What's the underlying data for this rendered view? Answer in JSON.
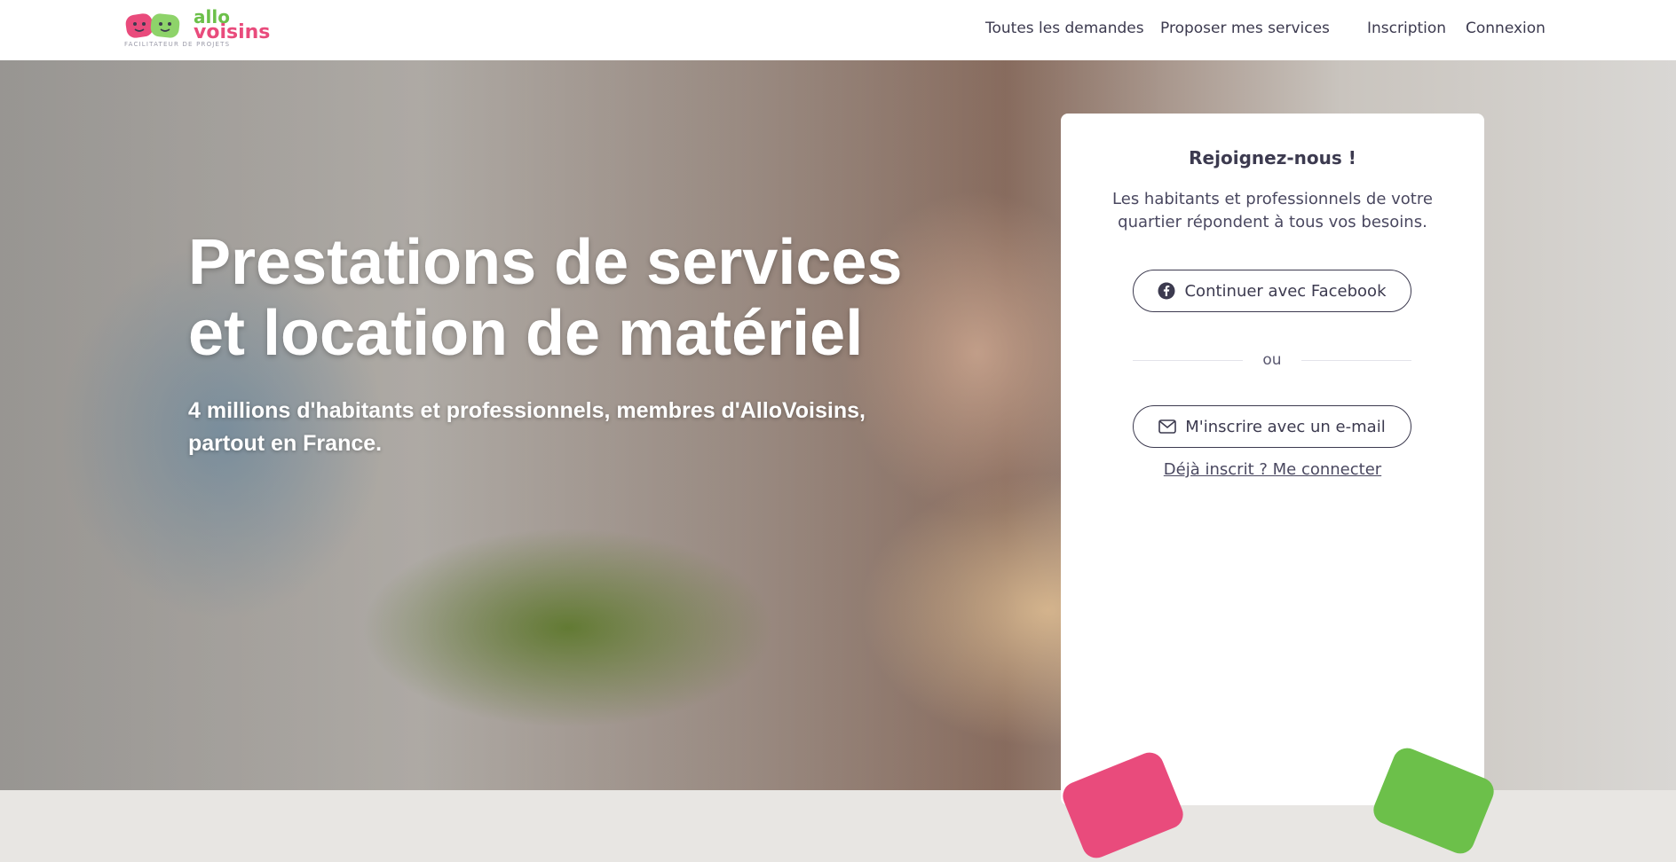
{
  "header": {
    "logo": {
      "line1": "allo",
      "line2": "voisins",
      "tagline": "FACILITATEUR DE PROJETS"
    },
    "nav": {
      "demandes": "Toutes les demandes",
      "proposer": "Proposer mes services",
      "inscription": "Inscription",
      "connexion": "Connexion"
    }
  },
  "hero": {
    "title_line1": "Prestations de services",
    "title_line2": "et location de matériel",
    "subtitle_line1": "4 millions d'habitants et professionnels, membres d'AlloVoisins,",
    "subtitle_line2": "partout en France."
  },
  "card": {
    "title": "Rejoignez-nous !",
    "description": "Les habitants et professionnels de votre quartier répondent à tous vos besoins.",
    "facebook_button": "Continuer avec Facebook",
    "divider": "ou",
    "email_button": "M'inscrire avec un e-mail",
    "login_link": "Déjà inscrit ? Me connecter"
  },
  "colors": {
    "brand_pink": "#e94b7c",
    "brand_green": "#6cc04a",
    "text_dark": "#3c3a4f"
  },
  "icons": {
    "facebook": "facebook-icon",
    "mail": "mail-icon"
  }
}
